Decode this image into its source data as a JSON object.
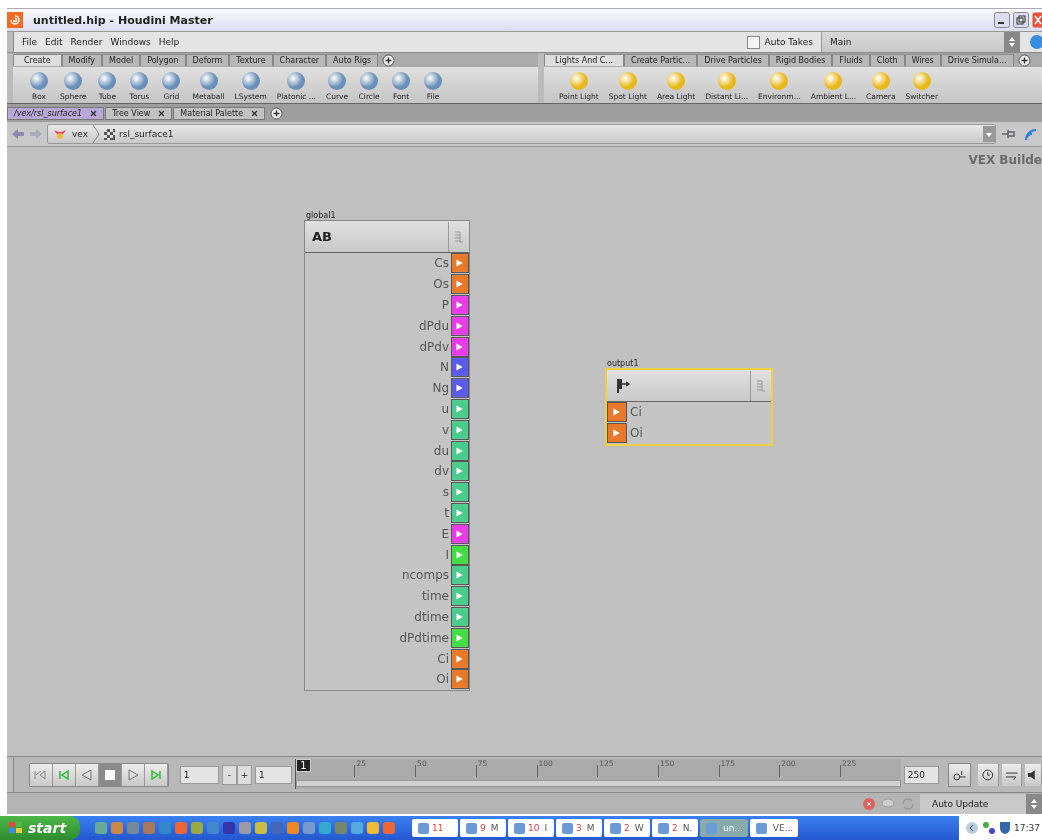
{
  "window": {
    "title": "untitled.hip - Houdini Master"
  },
  "menu": [
    "File",
    "Edit",
    "Render",
    "Windows",
    "Help"
  ],
  "auto_takes": {
    "label": "Auto Takes",
    "checked": false
  },
  "take": {
    "value": "Main"
  },
  "shelves": [
    {
      "tabs": [
        {
          "label": "Create",
          "selected": true
        },
        {
          "label": "Modify",
          "selected": false
        },
        {
          "label": "Model",
          "selected": false
        },
        {
          "label": "Polygon",
          "selected": false
        },
        {
          "label": "Deform",
          "selected": false
        },
        {
          "label": "Texture",
          "selected": false
        },
        {
          "label": "Character",
          "selected": false
        },
        {
          "label": "Auto Rigs",
          "selected": false
        }
      ],
      "tools": [
        "Box",
        "Sphere",
        "Tube",
        "Torus",
        "Grid",
        "Metaball",
        "LSystem",
        "Platonic ...",
        "Curve",
        "Circle",
        "Font",
        "File"
      ]
    },
    {
      "tabs": [
        {
          "label": "Lights And C...",
          "selected": true
        },
        {
          "label": "Create Partic...",
          "selected": false
        },
        {
          "label": "Drive Particles",
          "selected": false
        },
        {
          "label": "Rigid Bodies",
          "selected": false
        },
        {
          "label": "Fluids",
          "selected": false
        },
        {
          "label": "Cloth",
          "selected": false
        },
        {
          "label": "Wires",
          "selected": false
        },
        {
          "label": "Drive Simula...",
          "selected": false
        }
      ],
      "tools": [
        "Point Light",
        "Spot Light",
        "Area Light",
        "Distant Li...",
        "Environm...",
        "Ambient L...",
        "Camera",
        "Switcher"
      ]
    }
  ],
  "pane_tabs": [
    {
      "label": "/vex/rsl_surface1",
      "selected": true
    },
    {
      "label": "Tree View",
      "selected": false
    },
    {
      "label": "Material Palette",
      "selected": false
    }
  ],
  "path": [
    "vex",
    "rsl_surface1"
  ],
  "editor_label": "VEX Builde",
  "nodes": [
    {
      "name": "global1",
      "title": "AB",
      "kind": "outputs",
      "selected": false,
      "ports": [
        {
          "name": "Cs",
          "color": "#e8792a"
        },
        {
          "name": "Os",
          "color": "#e8792a"
        },
        {
          "name": "P",
          "color": "#e83ce8"
        },
        {
          "name": "dPdu",
          "color": "#e83ce8"
        },
        {
          "name": "dPdv",
          "color": "#e83ce8"
        },
        {
          "name": "N",
          "color": "#5a5ae8"
        },
        {
          "name": "Ng",
          "color": "#5a5ae8"
        },
        {
          "name": "u",
          "color": "#4ccc8c"
        },
        {
          "name": "v",
          "color": "#4ccc8c"
        },
        {
          "name": "du",
          "color": "#4ccc8c"
        },
        {
          "name": "dv",
          "color": "#4ccc8c"
        },
        {
          "name": "s",
          "color": "#4ccc8c"
        },
        {
          "name": "t",
          "color": "#4ccc8c"
        },
        {
          "name": "E",
          "color": "#e83ce8"
        },
        {
          "name": "I",
          "color": "#44dd44"
        },
        {
          "name": "ncomps",
          "color": "#4ccc8c"
        },
        {
          "name": "time",
          "color": "#4ccc8c"
        },
        {
          "name": "dtime",
          "color": "#4ccc8c"
        },
        {
          "name": "dPdtime",
          "color": "#44dd44"
        },
        {
          "name": "Ci",
          "color": "#e8792a"
        },
        {
          "name": "Oi",
          "color": "#e8792a"
        }
      ]
    },
    {
      "name": "output1",
      "kind": "inputs",
      "selected": true,
      "ports": [
        {
          "name": "Ci",
          "color": "#e8792a"
        },
        {
          "name": "Oi",
          "color": "#e8792a"
        }
      ]
    }
  ],
  "playbar": {
    "frame": "1",
    "step_buttons": [
      "-",
      "+"
    ],
    "start": "1",
    "marker": "1",
    "end": "250",
    "ticks": [
      "25",
      "50",
      "75",
      "100",
      "125",
      "150",
      "175",
      "200",
      "225"
    ]
  },
  "status": {
    "update_mode": "Auto Update"
  },
  "taskbar": {
    "start": "start",
    "tasks": [
      {
        "count": "11",
        "selected": false
      },
      {
        "count": "9",
        "label": "M",
        "selected": false
      },
      {
        "count": "10",
        "label": "I",
        "selected": false
      },
      {
        "count": "3",
        "label": "M",
        "selected": false
      },
      {
        "count": "2",
        "label": "W",
        "selected": false
      },
      {
        "count": "2",
        "label": "N.",
        "selected": false
      },
      {
        "label": "un...",
        "selected": true
      },
      {
        "label": "VE...",
        "selected": false
      }
    ],
    "clock": "17:37"
  }
}
